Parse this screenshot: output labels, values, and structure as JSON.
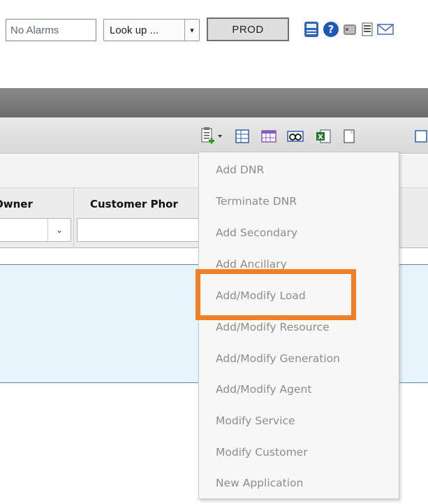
{
  "top_toolbar": {
    "alarms_label": "No Alarms",
    "lookup_label": "Look up ...",
    "lookup_arrow": "▾",
    "environment_label": "PROD",
    "icons": [
      "calculator-icon",
      "help-icon",
      "notes-icon",
      "document-icon",
      "mail-icon"
    ]
  },
  "grid": {
    "columns": [
      {
        "label": "Owner"
      },
      {
        "label": "Customer Phor"
      }
    ],
    "owner_dropdown_arrow": "⌄"
  },
  "toolbar_icons": [
    "add-clipboard-icon",
    "columns-icon",
    "table-icon",
    "binoculars-icon",
    "excel-icon",
    "page-icon"
  ],
  "menu": {
    "items": [
      "Add DNR",
      "Terminate DNR",
      "Add Secondary",
      "Add Ancillary",
      "Add/Modify Load",
      "Add/Modify Resource",
      "Add/Modify Generation",
      "Add/Modify Agent",
      "Modify Service",
      "Modify Customer",
      "New Application"
    ],
    "highlighted_item": "Add/Modify Load",
    "highlight_color": "#f07f26"
  }
}
